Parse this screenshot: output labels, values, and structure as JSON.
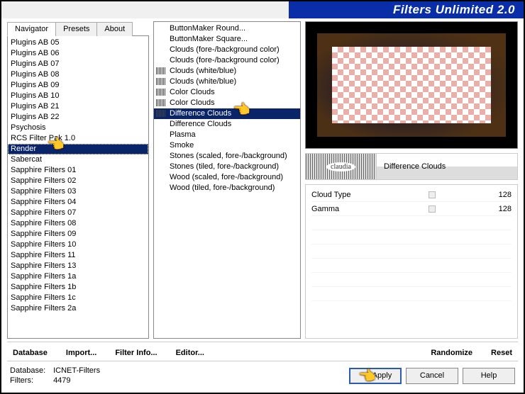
{
  "title": "Filters Unlimited 2.0",
  "tabs": {
    "navigator": "Navigator",
    "presets": "Presets",
    "about": "About"
  },
  "navigator_items": [
    "Plugins AB 05",
    "Plugins AB 06",
    "Plugins AB 07",
    "Plugins AB 08",
    "Plugins AB 09",
    "Plugins AB 10",
    "Plugins AB 21",
    "Plugins AB 22",
    "Psychosis",
    "RCS Filter Pak 1.0",
    "Render",
    "Sabercat",
    "Sapphire Filters 01",
    "Sapphire Filters 02",
    "Sapphire Filters 03",
    "Sapphire Filters 04",
    "Sapphire Filters 07",
    "Sapphire Filters 08",
    "Sapphire Filters 09",
    "Sapphire Filters 10",
    "Sapphire Filters 11",
    "Sapphire Filters 13",
    "Sapphire Filters 1a",
    "Sapphire Filters 1b",
    "Sapphire Filters 1c",
    "Sapphire Filters 2a"
  ],
  "navigator_selected": "Render",
  "filters": [
    {
      "label": "ButtonMaker Round...",
      "icon": false
    },
    {
      "label": "ButtonMaker Square...",
      "icon": false
    },
    {
      "label": "Clouds (fore-/background color)",
      "icon": false
    },
    {
      "label": "Clouds (fore-/background color)",
      "icon": false
    },
    {
      "label": "Clouds (white/blue)",
      "icon": true
    },
    {
      "label": "Clouds (white/blue)",
      "icon": true
    },
    {
      "label": "Color Clouds",
      "icon": true
    },
    {
      "label": "Color Clouds",
      "icon": true
    },
    {
      "label": "Difference Clouds",
      "icon": true,
      "selected": true
    },
    {
      "label": "Difference Clouds",
      "icon": false
    },
    {
      "label": "Plasma",
      "icon": false
    },
    {
      "label": "Smoke",
      "icon": false
    },
    {
      "label": "Stones (scaled, fore-/background)",
      "icon": false
    },
    {
      "label": "Stones (tiled, fore-/background)",
      "icon": false
    },
    {
      "label": "Wood (scaled, fore-/background)",
      "icon": false
    },
    {
      "label": "Wood (tiled, fore-/background)",
      "icon": false
    }
  ],
  "logo_text": "claudia",
  "selected_filter_name": "Difference Clouds",
  "params": [
    {
      "name": "Cloud Type",
      "value": 128,
      "max": 255
    },
    {
      "name": "Gamma",
      "value": 128,
      "max": 255
    }
  ],
  "link_buttons": {
    "database": "Database",
    "import": "Import...",
    "filter_info": "Filter Info...",
    "editor": "Editor...",
    "randomize": "Randomize",
    "reset": "Reset"
  },
  "footer": {
    "db_label": "Database:",
    "db_value": "ICNET-Filters",
    "filters_label": "Filters:",
    "filters_value": "4479"
  },
  "buttons": {
    "apply": "Apply",
    "cancel": "Cancel",
    "help": "Help"
  }
}
